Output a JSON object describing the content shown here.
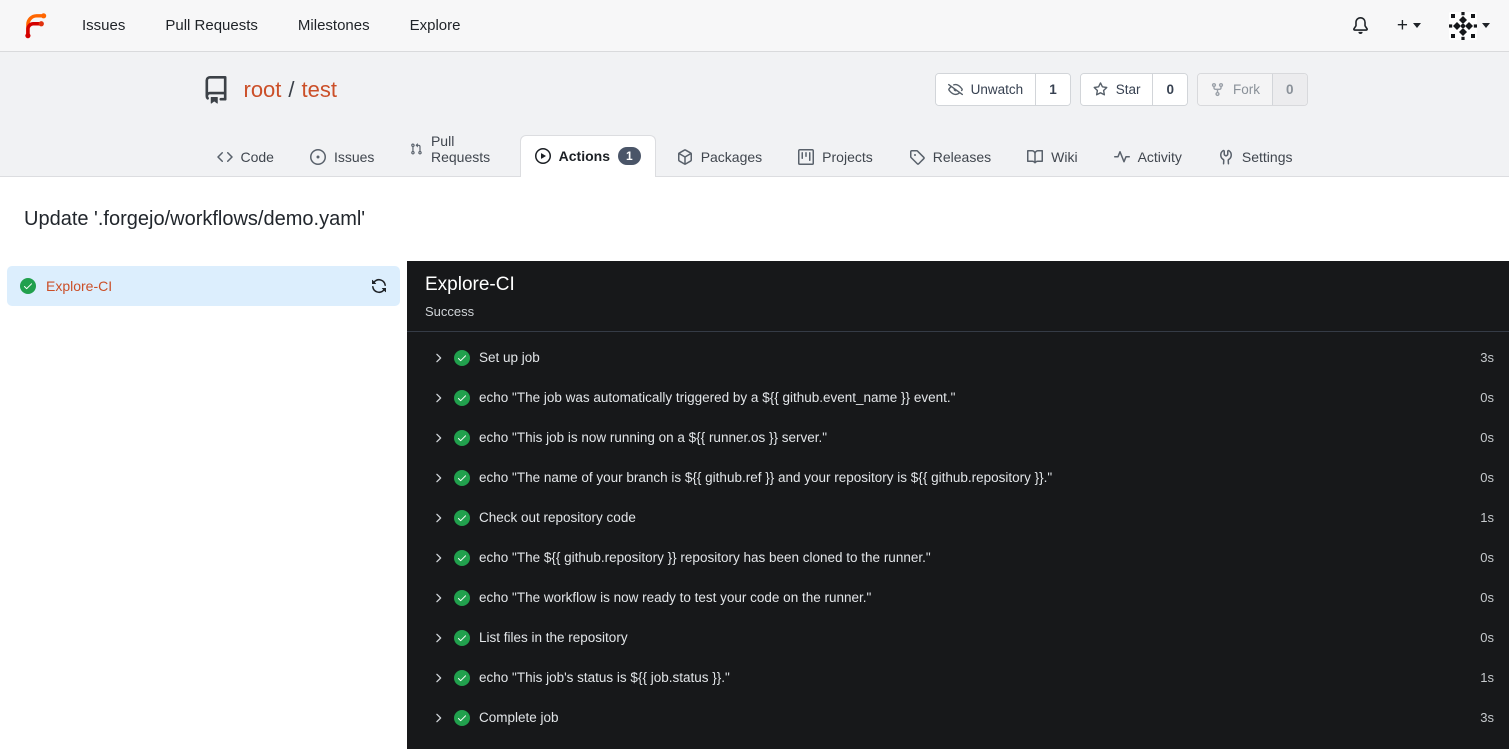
{
  "colors": {
    "link-red": "#cb4f28",
    "success-green": "#21a04d",
    "selected-blue-bg": "#dceefd",
    "dark-panel-bg": "#17181a",
    "badge-bg": "#4a5568",
    "brand-orange": "#ff6600",
    "brand-red": "#d40000"
  },
  "navbar": {
    "items": [
      {
        "label": "Issues"
      },
      {
        "label": "Pull Requests"
      },
      {
        "label": "Milestones"
      },
      {
        "label": "Explore"
      }
    ],
    "new_label": "+"
  },
  "repo": {
    "owner": "root",
    "separator": "/",
    "name": "test",
    "actions": {
      "unwatch": {
        "label": "Unwatch",
        "count": "1"
      },
      "star": {
        "label": "Star",
        "count": "0"
      },
      "fork": {
        "label": "Fork",
        "count": "0",
        "disabled": true
      }
    },
    "tabs": [
      {
        "label": "Code"
      },
      {
        "label": "Issues"
      },
      {
        "label": "Pull Requests"
      },
      {
        "label": "Actions",
        "badge": "1",
        "active": true
      },
      {
        "label": "Packages"
      },
      {
        "label": "Projects"
      },
      {
        "label": "Releases"
      },
      {
        "label": "Wiki"
      },
      {
        "label": "Activity"
      },
      {
        "label": "Settings"
      }
    ]
  },
  "run": {
    "title": "Update '.forgejo/workflows/demo.yaml'",
    "jobs": [
      {
        "name": "Explore-CI",
        "status": "success"
      }
    ],
    "job_detail": {
      "name": "Explore-CI",
      "status_text": "Success",
      "steps": [
        {
          "name": "Set up job",
          "duration": "3s"
        },
        {
          "name": "echo \"The job was automatically triggered by a ${{ github.event_name }} event.\"",
          "duration": "0s"
        },
        {
          "name": "echo \"This job is now running on a ${{ runner.os }} server.\"",
          "duration": "0s"
        },
        {
          "name": "echo \"The name of your branch is ${{ github.ref }} and your repository is ${{ github.repository }}.\"",
          "duration": "0s"
        },
        {
          "name": "Check out repository code",
          "duration": "1s"
        },
        {
          "name": "echo \"The ${{ github.repository }} repository has been cloned to the runner.\"",
          "duration": "0s"
        },
        {
          "name": "echo \"The workflow is now ready to test your code on the runner.\"",
          "duration": "0s"
        },
        {
          "name": "List files in the repository",
          "duration": "0s"
        },
        {
          "name": "echo \"This job's status is ${{ job.status }}.\"",
          "duration": "1s"
        },
        {
          "name": "Complete job",
          "duration": "3s"
        }
      ]
    }
  }
}
